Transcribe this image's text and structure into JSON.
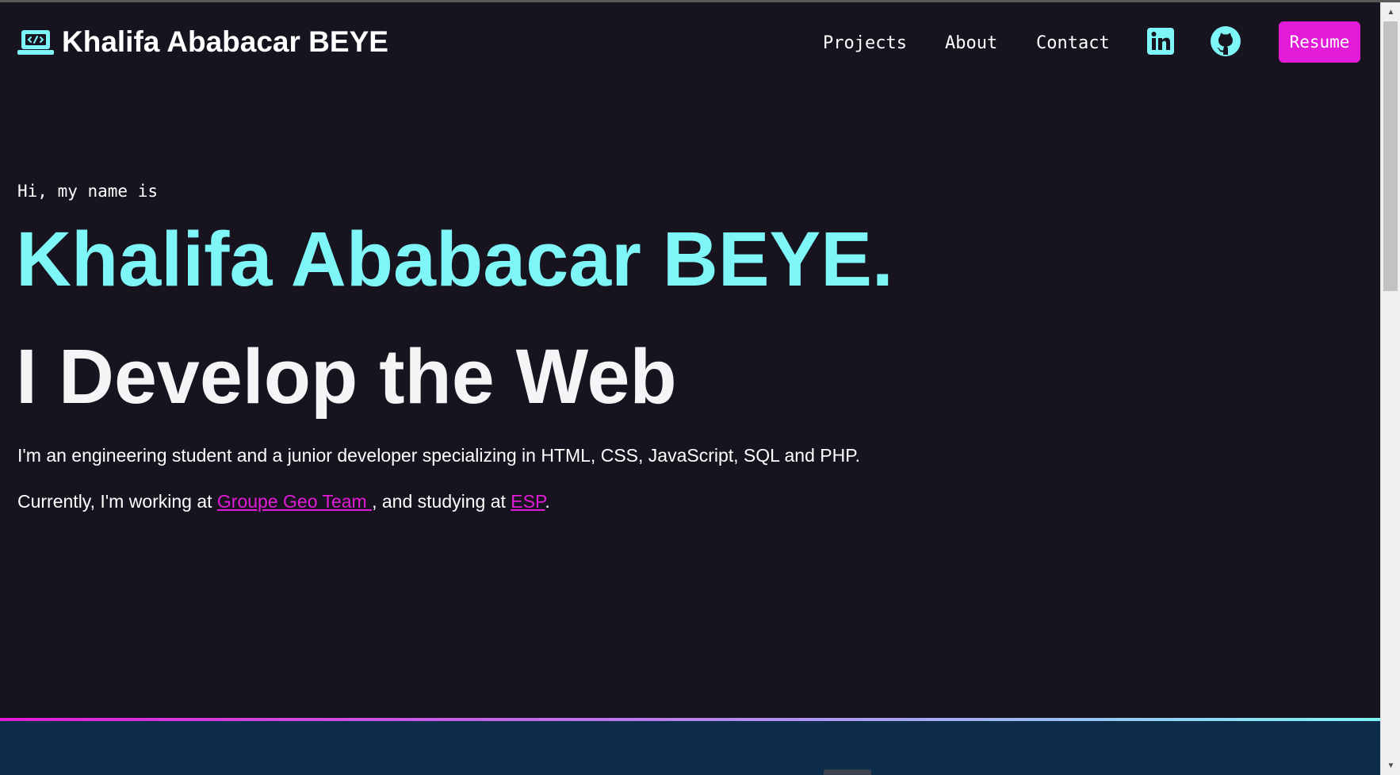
{
  "header": {
    "brand_icon": "laptop-code-icon",
    "brand_name": "Khalifa Ababacar BEYE",
    "nav": [
      {
        "label": "Projects"
      },
      {
        "label": "About"
      },
      {
        "label": "Contact"
      }
    ],
    "social": [
      {
        "icon": "linkedin-icon"
      },
      {
        "icon": "github-icon"
      }
    ],
    "resume_label": "Resume"
  },
  "hero": {
    "greeting": "Hi, my name is",
    "name": "Khalifa Ababacar BEYE.",
    "tagline": "I Develop the Web",
    "intro": "I'm an engineering student and a junior developer specializing in HTML, CSS, JavaScript, SQL and PHP.",
    "current_prefix": "Currently, I'm working at ",
    "company_link": "Groupe Geo Team ",
    "current_middle": ", and studying at ",
    "school_link": "ESP",
    "current_suffix": "."
  },
  "colors": {
    "background": "#17141f",
    "accent_cyan": "#7ef6f7",
    "accent_magenta": "#e21bd8",
    "next_section": "#0d2d4a"
  }
}
